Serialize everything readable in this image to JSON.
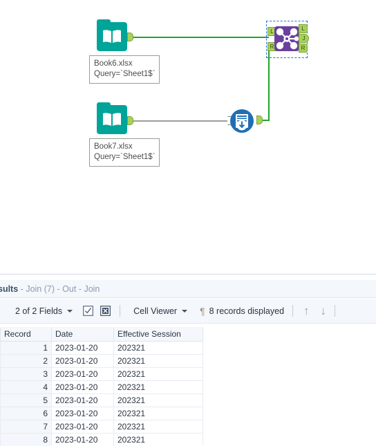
{
  "canvas": {
    "tools": [
      {
        "id": "input-book6",
        "type": "input-data-tool",
        "icon": "book-folder-icon",
        "label_line1": "Book6.xlsx",
        "label_line2": "Query=`Sheet1$`"
      },
      {
        "id": "input-book7",
        "type": "input-data-tool",
        "icon": "book-folder-icon",
        "label_line1": "Book7.xlsx",
        "label_line2": "Query=`Sheet1$`"
      },
      {
        "id": "join-tool",
        "type": "join-tool",
        "icon": "join-nodes-icon",
        "selected": true,
        "input_ports": [
          "L",
          "R"
        ],
        "output_ports": [
          "L",
          "J",
          "R"
        ]
      },
      {
        "id": "output-tool",
        "type": "output-data-tool",
        "icon": "output-data-icon"
      }
    ],
    "colors": {
      "input_tool": "#00a499",
      "join_tool": "#6b3fa0",
      "output_tool": "#1f6fb2",
      "wire_active": "#22a32a",
      "wire_idle": "#9c9c9c",
      "anchor": "#a8d15a",
      "selection": "#1f6fd6"
    }
  },
  "results": {
    "title": {
      "name": "sults",
      "sep1": "-",
      "tool": "Join (7)",
      "sep2": "-",
      "anchor": "Out",
      "sep3": "-",
      "label": "Join"
    },
    "toolbar": {
      "fields_label": "2 of 2 Fields",
      "select_all_icon": "checkbox-checked-icon",
      "deselect_all_icon": "checkbox-x-icon",
      "viewer_label": "Cell Viewer",
      "pilcrow_icon": "pilcrow-icon",
      "records_label": "8 records displayed",
      "up_icon": "arrow-up-icon",
      "down_icon": "arrow-down-icon"
    },
    "table": {
      "columns": [
        "Record",
        "Date",
        "Effective Session"
      ],
      "rows": [
        [
          "1",
          "2023-01-20",
          "202321"
        ],
        [
          "2",
          "2023-01-20",
          "202321"
        ],
        [
          "3",
          "2023-01-20",
          "202321"
        ],
        [
          "4",
          "2023-01-20",
          "202321"
        ],
        [
          "5",
          "2023-01-20",
          "202321"
        ],
        [
          "6",
          "2023-01-20",
          "202321"
        ],
        [
          "7",
          "2023-01-20",
          "202321"
        ],
        [
          "8",
          "2023-01-20",
          "202321"
        ]
      ]
    }
  }
}
